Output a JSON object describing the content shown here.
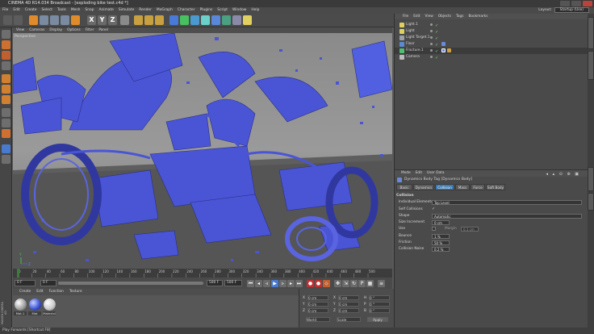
{
  "window": {
    "title": "CINEMA 4D R14.034 Broadcast - [exploding bike test.c4d *]"
  },
  "menu": [
    "File",
    "Edit",
    "Create",
    "Select",
    "Tools",
    "Mesh",
    "Snap",
    "Animate",
    "Simulate",
    "Render",
    "MoGraph",
    "Character",
    "Plugins",
    "Script",
    "Window",
    "Help"
  ],
  "layout": {
    "label": "Layout:",
    "value": "Startup (Use)"
  },
  "toolbar": {
    "x_label": "X",
    "y_label": "Y",
    "z_label": "Z"
  },
  "viewport": {
    "menu": [
      "View",
      "Cameras",
      "Display",
      "Options",
      "Filter",
      "Panel"
    ],
    "label": "Perspective",
    "axis_y": "Y",
    "axis_z": "Z"
  },
  "timeline": {
    "ticks": [
      "0",
      "20",
      "40",
      "60",
      "80",
      "100",
      "120",
      "140",
      "160",
      "180",
      "200",
      "220",
      "240",
      "260",
      "280",
      "300",
      "320",
      "340",
      "360",
      "380",
      "400",
      "420",
      "440",
      "460",
      "480",
      "500"
    ],
    "current_frame": "0 F",
    "start_field": "0 F",
    "end_field": "500 F",
    "end_field_2": "500 F"
  },
  "materials": {
    "menu": [
      "Create",
      "Edit",
      "Function",
      "Texture"
    ],
    "items": [
      {
        "label": "Mat.1",
        "color": "#cfcfcf"
      },
      {
        "label": "Mat",
        "color": "#4158d8"
      },
      {
        "label": "Material",
        "color": "#e8e8e8"
      }
    ],
    "logo_text": "MAXON CINEMA 4D"
  },
  "coordinates": {
    "rows": [
      {
        "axis": "X",
        "val": "0 cm",
        "axis2": "X",
        "val2": "0 cm",
        "axis3": "H",
        "val3": "0 °"
      },
      {
        "axis": "Y",
        "val": "0 cm",
        "axis2": "Y",
        "val2": "0 cm",
        "axis3": "P",
        "val3": "0 °"
      },
      {
        "axis": "Z",
        "val": "0 cm",
        "axis2": "Z",
        "val2": "0 cm",
        "axis3": "B",
        "val3": "0 °"
      }
    ],
    "dropdown1": "World",
    "dropdown2": "Scale",
    "apply": "Apply"
  },
  "object_manager": {
    "menu": [
      "File",
      "Edit",
      "View",
      "Objects",
      "Tags",
      "Bookmarks"
    ],
    "objects": [
      {
        "name": "Light.1",
        "icon": "light-icon",
        "color": "#e0d060"
      },
      {
        "name": "Light",
        "icon": "light-icon",
        "color": "#e0d060"
      },
      {
        "name": "Light Target.1",
        "icon": "null-icon",
        "color": "#9aa0a8"
      },
      {
        "name": "Floor",
        "icon": "floor-icon",
        "color": "#5a8ad0"
      },
      {
        "name": "Fracture.1",
        "icon": "fracture-icon",
        "color": "#50c070"
      },
      {
        "name": "Camera",
        "icon": "camera-icon",
        "color": "#bbbbbb"
      }
    ]
  },
  "attributes": {
    "menu": [
      "Mode",
      "Edit",
      "User Data"
    ],
    "tag_title": "Dynamics Body Tag [Dynamics Body]",
    "tabs": [
      "Basic",
      "Dynamics",
      "Collision",
      "Mass",
      "Force",
      "Soft Body"
    ],
    "active_tab": "Collision",
    "section": "Collision",
    "params": [
      {
        "label": "Individual Elements",
        "value": "Top Level"
      },
      {
        "label": "Self Collisions",
        "value": "✓"
      },
      {
        "label": "Shape",
        "value": "Automatic"
      },
      {
        "label": "Size Increment",
        "value": "0 cm"
      },
      {
        "label": "Use",
        "value": "",
        "extra_label": "Margin",
        "extra_value": "0.1 cm"
      },
      {
        "label": "Bounce",
        "value": "1 %"
      },
      {
        "label": "Friction",
        "value": "50 %"
      },
      {
        "label": "Collision Noise",
        "value": "0.2 %"
      }
    ]
  },
  "status": {
    "text": "Play Forwards [Shortcut F8]"
  }
}
